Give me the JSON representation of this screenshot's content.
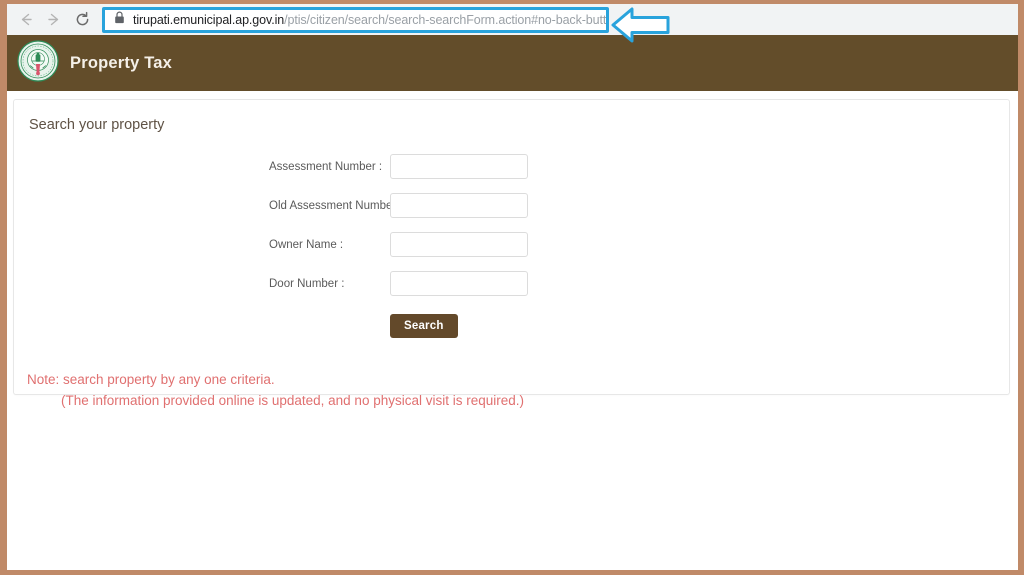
{
  "browser": {
    "back_icon": "arrow-left-icon",
    "forward_icon": "arrow-right-icon",
    "reload_icon": "reload-icon",
    "lock_icon": "lock-icon",
    "url_domain": "tirupati.emunicipal.ap.gov.in",
    "url_path": "/ptis/citizen/search/search-searchForm.action#no-back-button",
    "url_full": "tirupati.emunicipal.ap.gov.in/ptis/citizen/search/search-searchForm.action#no-back-button",
    "highlight_color": "#29a3dc",
    "annotation_icon": "left-arrow-callout-icon"
  },
  "header": {
    "logo_icon": "ap-government-emblem-icon",
    "title": "Property Tax",
    "background_color": "#634d2a"
  },
  "main": {
    "card_title": "Search your property",
    "fields": [
      {
        "label": "Assessment Number :",
        "value": "",
        "placeholder": ""
      },
      {
        "label": "Old Assessment Number :",
        "value": "",
        "placeholder": ""
      },
      {
        "label": "Owner Name :",
        "value": "",
        "placeholder": ""
      },
      {
        "label": "Door Number :",
        "value": "",
        "placeholder": ""
      }
    ],
    "search_button_label": "Search",
    "search_button_color": "#63492a",
    "note_line1": "Note: search property by any one criteria.",
    "note_line2": "(The information provided online is updated, and no physical visit is required.)",
    "note_color": "#e07070"
  }
}
